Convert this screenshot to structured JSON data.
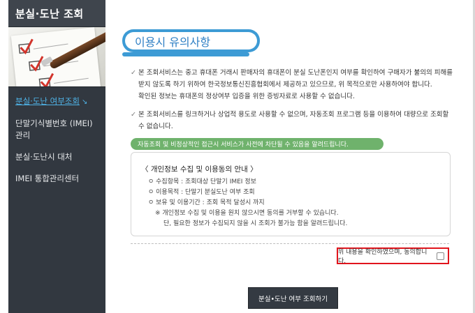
{
  "sidebar": {
    "header": "분실·도난 조회",
    "items": [
      {
        "label": "분실·도난 여부조회",
        "active": true,
        "arrow": "↘"
      },
      {
        "label": "단말기식별번호 (IMEI) 관리"
      },
      {
        "label": "분실·도난시 대처"
      },
      {
        "label": "IMEI 통합관리센터"
      }
    ]
  },
  "main": {
    "title": "이용시 유의사항",
    "check_icon": "✓",
    "notices": [
      {
        "line1": "본 조회서비스는 중고 휴대폰 거래시 판매자의 휴대폰이 분실 도난폰인지 여부를 확인하여 구매자가 불의의 피해를",
        "line2": "받지 않도록 하기 위하여 한국정보통신진흥협회에서 제공하고 있으므로, 위 목적으로만 사용하여야 합니다.",
        "line3": "확인된 정보는 휴대폰의 정상여부 입증을 위한 증빙자료로 사용할 수 없습니다."
      },
      {
        "line1": "본 조회서비스를 링크하거나 상업적 용도로 사용할 수 없으며, 자동조회 프로그램 등을 이용하여 대량으로 조회할",
        "line2": "수 없습니다."
      }
    ],
    "banner": "자동조회 및 비정상적인 접근시 서비스가 사전에 차단될 수 있음을 알려드립니다.",
    "privacy": {
      "title": "〈 개인정보 수집 및 이용동의 안내 〉",
      "items": [
        "ㅇ 수집항목 : 조회대상 단말기 IMEI 정보",
        "ㅇ 이용목적 : 단말기 분실도난 여부 조회",
        "ㅇ 보유 및 이용기간 : 조회 목적 달성시 까지"
      ],
      "note1": "※ 개인정보 수집 및 이용을 원치 않으시면 동의를 거부할 수 있습니다.",
      "note2": "단, 필요한 정보가 수집되지 않을 시 조회가 불가능 함을 알려드립니다."
    },
    "agree_label": "위 내용을 확인하였으며, 동의합니다.",
    "agree_checked": false,
    "submit_label": "분실•도난 여부 조회하기"
  },
  "colors": {
    "sidebar_bg": "#323840",
    "active_link": "#4fb4e8",
    "title_accent": "#3d9bd5",
    "banner_green": "#6fb26c",
    "agree_highlight": "#e1141c",
    "button_bg": "#343a42"
  }
}
